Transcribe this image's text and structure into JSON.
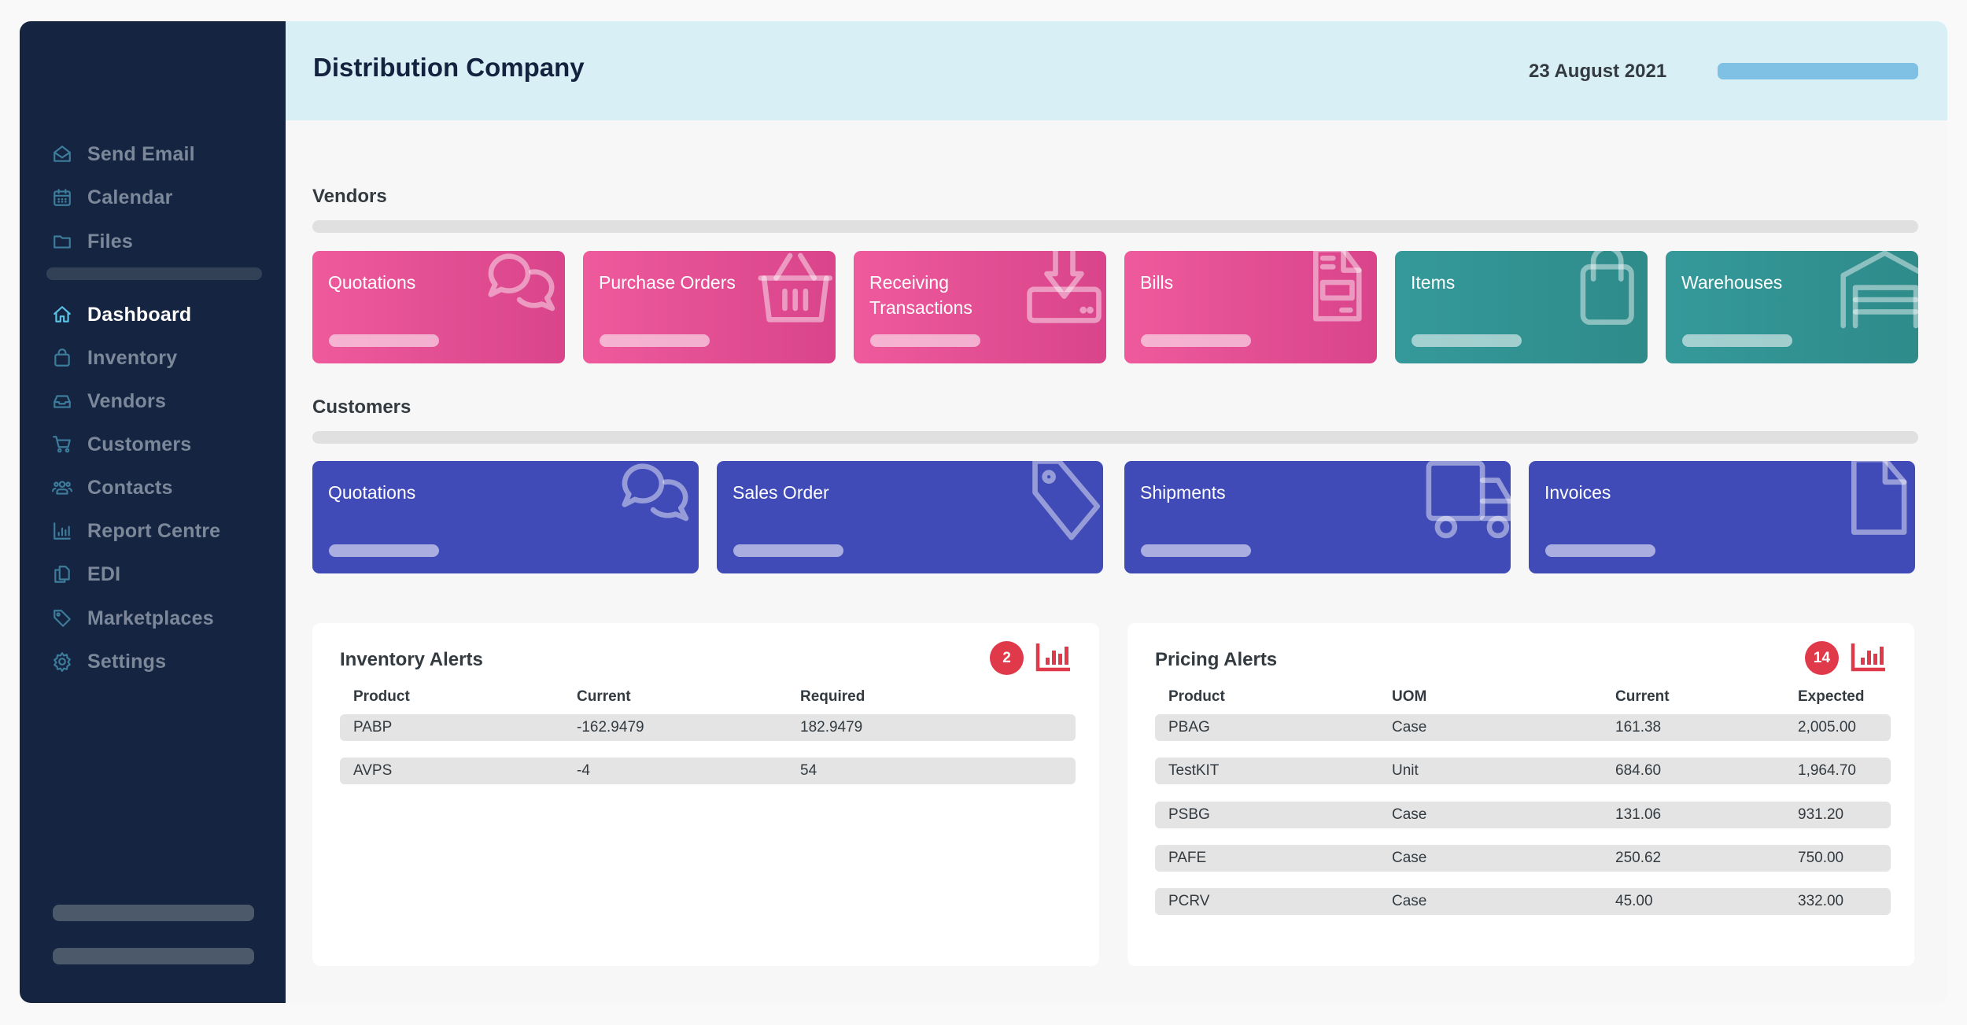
{
  "app": {
    "title": "Distribution Company",
    "date": "23 August 2021"
  },
  "sidebar": {
    "top_items": [
      {
        "label": "Send Email",
        "icon": "envelope-open-icon"
      },
      {
        "label": "Calendar",
        "icon": "calendar-icon"
      },
      {
        "label": "Files",
        "icon": "folder-icon"
      }
    ],
    "items": [
      {
        "label": "Dashboard",
        "icon": "home-icon",
        "active": true
      },
      {
        "label": "Inventory",
        "icon": "shopping-bag-icon"
      },
      {
        "label": "Vendors",
        "icon": "inbox-icon"
      },
      {
        "label": "Customers",
        "icon": "cart-icon"
      },
      {
        "label": "Contacts",
        "icon": "users-icon"
      },
      {
        "label": "Report Centre",
        "icon": "bar-chart-icon"
      },
      {
        "label": "EDI",
        "icon": "copy-icon"
      },
      {
        "label": "Marketplaces",
        "icon": "tag-icon"
      },
      {
        "label": "Settings",
        "icon": "gear-icon"
      }
    ]
  },
  "vendors": {
    "label": "Vendors",
    "tiles": [
      {
        "label": "Quotations",
        "icon": "chat-bubbles-icon",
        "color": "#e8509a"
      },
      {
        "label": "Purchase Orders",
        "icon": "basket-icon",
        "color": "#e8509a"
      },
      {
        "label": "Receiving Transactions",
        "icon": "download-tray-icon",
        "color": "#e8509a"
      },
      {
        "label": "Bills",
        "icon": "document-icon",
        "color": "#e8509a"
      },
      {
        "label": "Items",
        "icon": "shopping-bag-icon",
        "color": "#329494"
      },
      {
        "label": "Warehouses",
        "icon": "warehouse-icon",
        "color": "#329494"
      }
    ]
  },
  "customers": {
    "label": "Customers",
    "tiles": [
      {
        "label": "Quotations",
        "icon": "chat-bubbles-icon",
        "color": "#404bb8"
      },
      {
        "label": "Sales Order",
        "icon": "tag-icon",
        "color": "#404bb8"
      },
      {
        "label": "Shipments",
        "icon": "truck-icon",
        "color": "#404bb8"
      },
      {
        "label": "Invoices",
        "icon": "file-icon",
        "color": "#404bb8"
      }
    ]
  },
  "inventory_alerts": {
    "title": "Inventory Alerts",
    "count": "2",
    "columns": [
      "Product",
      "Current",
      "Required"
    ],
    "rows": [
      [
        "PABP",
        "-162.9479",
        "182.9479"
      ],
      [
        "AVPS",
        "-4",
        "54"
      ]
    ]
  },
  "pricing_alerts": {
    "title": "Pricing Alerts",
    "count": "14",
    "columns": [
      "Product",
      "UOM",
      "Current",
      "Expected"
    ],
    "rows": [
      [
        "PBAG",
        "Case",
        "161.38",
        "2,005.00"
      ],
      [
        "TestKIT",
        "Unit",
        "684.60",
        "1,964.70"
      ],
      [
        "PSBG",
        "Case",
        "131.06",
        "931.20"
      ],
      [
        "PAFE",
        "Case",
        "250.62",
        "750.00"
      ],
      [
        "PCRV",
        "Case",
        "45.00",
        "332.00"
      ]
    ]
  },
  "colors": {
    "sidebar_bg": "#152541",
    "header_bg": "#d9eff6",
    "accent_blue": "#7fc1e5",
    "vendor_pink": "#e8509a",
    "vendor_teal": "#329494",
    "customer_indigo": "#404bb8",
    "alert_red": "#e03a4a"
  }
}
